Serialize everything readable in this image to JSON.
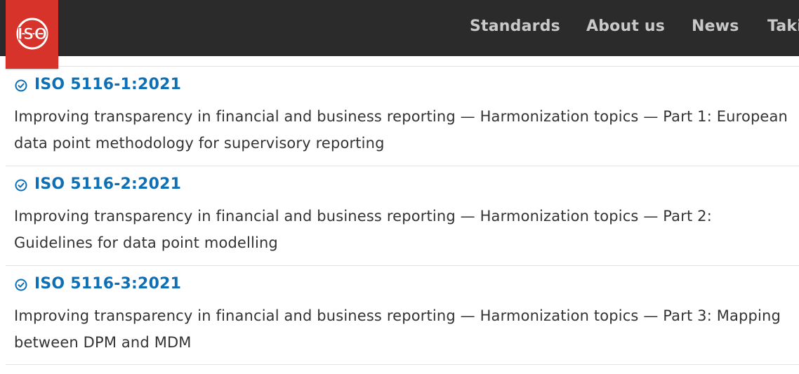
{
  "header": {
    "logo_text": "ISO",
    "nav": [
      "Standards",
      "About us",
      "News",
      "Taki"
    ]
  },
  "colors": {
    "header_bg": "#2b2b2b",
    "logo_red": "#d7332a",
    "link_blue": "#0f6fb4",
    "nav_text": "#c9c9c9",
    "body_text": "#333333"
  },
  "standards": [
    {
      "code": "ISO 5116-1:2021",
      "title": "Improving transparency in financial and business reporting — Harmonization topics — Part 1: European data point methodology for supervisory reporting",
      "status_icon": "check-circle-icon"
    },
    {
      "code": "ISO 5116-2:2021",
      "title": "Improving transparency in financial and business reporting — Harmonization topics — Part 2: Guidelines for data point modelling",
      "status_icon": "check-circle-icon"
    },
    {
      "code": "ISO 5116-3:2021",
      "title": "Improving transparency in financial and business reporting — Harmonization topics — Part 3: Mapping between DPM and MDM",
      "status_icon": "check-circle-icon"
    }
  ]
}
